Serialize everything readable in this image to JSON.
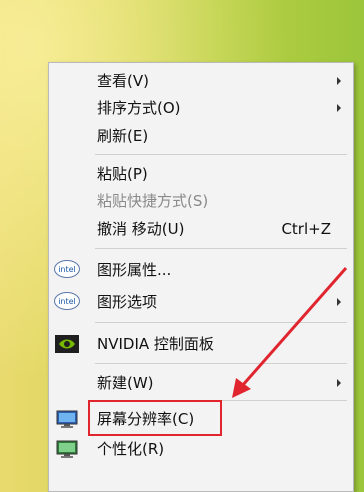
{
  "menu": {
    "view": {
      "label": "查看(V)"
    },
    "sort": {
      "label": "排序方式(O)"
    },
    "refresh": {
      "label": "刷新(E)"
    },
    "paste": {
      "label": "粘贴(P)"
    },
    "paste_shortcut": {
      "label": "粘贴快捷方式(S)"
    },
    "undo_move": {
      "label": "撤消 移动(U)",
      "shortcut": "Ctrl+Z"
    },
    "graphics_properties": {
      "label": "图形属性..."
    },
    "graphics_options": {
      "label": "图形选项"
    },
    "nvidia": {
      "label": "NVIDIA 控制面板"
    },
    "new": {
      "label": "新建(W)"
    },
    "resolution": {
      "label": "屏幕分辨率(C)"
    },
    "personalize": {
      "label": "个性化(R)"
    }
  },
  "icons": {
    "intel_text": "intel"
  },
  "colors": {
    "highlight_box": "#e0252f",
    "arrow": "#e0252f",
    "nvidia_green": "#76b900"
  }
}
